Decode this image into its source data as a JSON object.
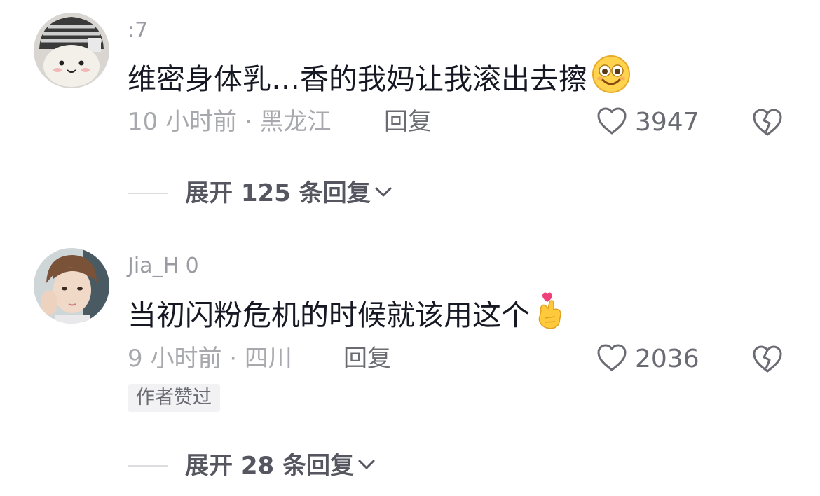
{
  "comments": [
    {
      "username": ":7",
      "text": "维密身体乳…香的我妈让我滚出去擦",
      "emoji": "smiling-face-emoji",
      "time": "10 小时前 · 黑龙江",
      "reply_label": "回复",
      "likes": "3947",
      "expand_label": "展开 125 条回复"
    },
    {
      "username": "Jia_H  0",
      "text": "当初闪粉危机的时候就该用这个",
      "emoji": "finger-heart-emoji",
      "time": "9 小时前 · 四川",
      "reply_label": "回复",
      "likes": "2036",
      "badge": "作者赞过",
      "expand_label": "展开 28 条回复"
    }
  ],
  "colors": {
    "text_primary": "#161823",
    "text_secondary": "#9b9ca3",
    "icon": "#6b6c73",
    "badge_bg": "#f2f2f4"
  }
}
